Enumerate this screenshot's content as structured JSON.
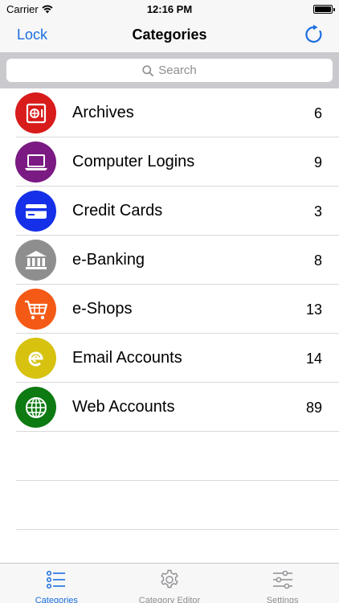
{
  "status_bar": {
    "carrier": "Carrier",
    "time": "12:16 PM"
  },
  "nav": {
    "left_button": "Lock",
    "title": "Categories"
  },
  "search": {
    "placeholder": "Search"
  },
  "categories": [
    {
      "name": "Archives",
      "count": "6",
      "icon": "safe-icon",
      "color": "#d81b1b"
    },
    {
      "name": "Computer Logins",
      "count": "9",
      "icon": "laptop-icon",
      "color": "#7a1a82"
    },
    {
      "name": "Credit Cards",
      "count": "3",
      "icon": "credit-card-icon",
      "color": "#1530e8"
    },
    {
      "name": "e-Banking",
      "count": "8",
      "icon": "bank-icon",
      "color": "#8e8e8e"
    },
    {
      "name": "e-Shops",
      "count": "13",
      "icon": "shopping-cart-icon",
      "color": "#f45a16"
    },
    {
      "name": "Email Accounts",
      "count": "14",
      "icon": "email-icon",
      "color": "#d6c20f"
    },
    {
      "name": "Web Accounts",
      "count": "89",
      "icon": "globe-icon",
      "color": "#0e7a12"
    }
  ],
  "tabs": [
    {
      "label": "Categories",
      "icon": "list-icon",
      "active": true
    },
    {
      "label": "Category Editor",
      "icon": "gear-icon",
      "active": false
    },
    {
      "label": "Settings",
      "icon": "sliders-icon",
      "active": false
    }
  ],
  "colors": {
    "accent": "#1a6ee0"
  }
}
